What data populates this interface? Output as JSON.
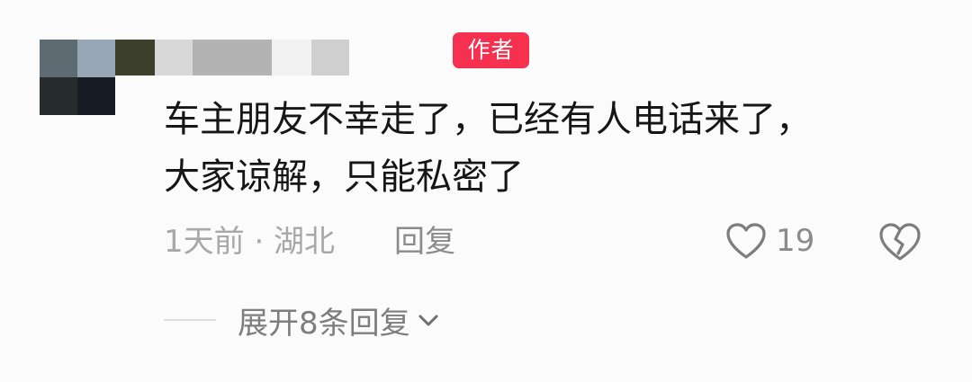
{
  "comment": {
    "author_badge": "作者",
    "text_lines": [
      "车主朋友不幸走了，已经有人电话来了，",
      "大家谅解，只能私密了"
    ],
    "meta": "1天前 · 湖北",
    "reply_label": "回复",
    "like_count": "19",
    "expand_label": "展开8条回复"
  },
  "icons": {
    "like": "heart-outline-icon",
    "dislike": "broken-heart-icon",
    "expand": "chevron-down-icon"
  },
  "colors": {
    "author_badge_bg": "#f5314f",
    "text_primary": "#161616",
    "text_secondary": "#a8a8a8"
  }
}
